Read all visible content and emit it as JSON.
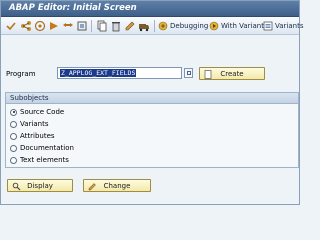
{
  "window": {
    "title": "ABAP Editor: Initial Screen"
  },
  "toolbar": {
    "icons": [
      "check-icon",
      "where-used-icon",
      "display-object-list-icon",
      "activate-icon",
      "test-icon",
      "object-directory-icon",
      "copy-icon",
      "delete-icon",
      "rename-icon",
      "transport-icon"
    ],
    "debugging_label": "Debugging",
    "with_variant_label": "With Variant",
    "variants_label": "Variants"
  },
  "program": {
    "label": "Program",
    "value": "Z_APPLOG_EXT_FIELDS",
    "create_label": "Create"
  },
  "subobjects": {
    "title": "Subobjects",
    "options": [
      {
        "label": "Source Code",
        "selected": true
      },
      {
        "label": "Variants",
        "selected": false
      },
      {
        "label": "Attributes",
        "selected": false
      },
      {
        "label": "Documentation",
        "selected": false
      },
      {
        "label": "Text elements",
        "selected": false
      }
    ]
  },
  "actions": {
    "display_label": "Display",
    "change_label": "Change"
  },
  "colors": {
    "title_bar": "#4a6b96",
    "button_face": "#f8efbe",
    "selection": "#1b3b8a"
  }
}
